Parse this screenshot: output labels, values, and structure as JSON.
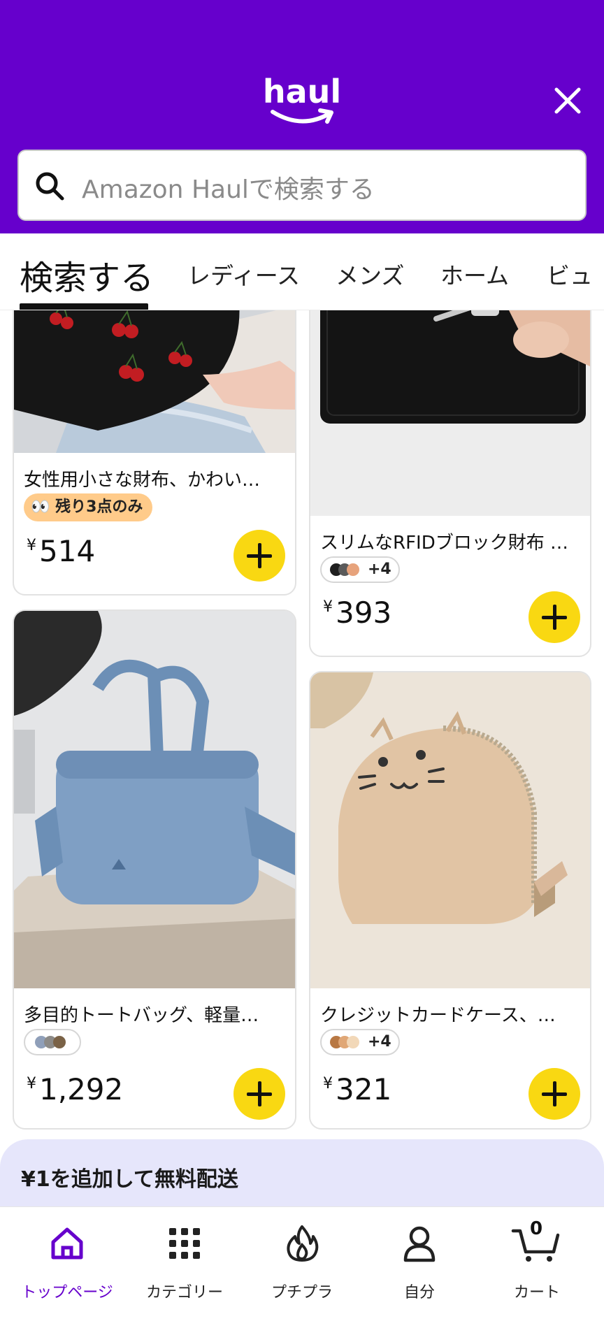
{
  "header": {
    "logo_text": "haul",
    "search_placeholder": "Amazon Haulで検索する"
  },
  "tabs": [
    {
      "label": "検索する",
      "active": true
    },
    {
      "label": "レディース"
    },
    {
      "label": "メンズ"
    },
    {
      "label": "ホーム"
    },
    {
      "label": "ビュ"
    }
  ],
  "products": [
    {
      "title": "女性用小さな財布、かわい…",
      "badge": "残り3点のみ",
      "price_currency": "¥",
      "price": "514"
    },
    {
      "title": "スリムなRFIDブロック財布 …",
      "swatch_more": "+4",
      "price_currency": "¥",
      "price": "393"
    },
    {
      "title": "多目的トートバッグ、軽量…",
      "price_currency": "¥",
      "price": "1,292"
    },
    {
      "title": "クレジットカードケース、…",
      "swatch_more": "+4",
      "price_currency": "¥",
      "price": "321"
    }
  ],
  "banner": {
    "text": "¥1を追加して無料配送"
  },
  "bottom_nav": [
    {
      "label": "トップページ",
      "icon": "home-icon",
      "active": true
    },
    {
      "label": "カテゴリー",
      "icon": "grid-icon"
    },
    {
      "label": "プチプラ",
      "icon": "flame-icon"
    },
    {
      "label": "自分",
      "icon": "person-icon"
    },
    {
      "label": "カート",
      "icon": "cart-icon",
      "count": "0"
    }
  ],
  "colors": {
    "brand": "#6600cc",
    "add_button": "#f9d812",
    "banner_bg": "#e6e6fb",
    "stock_badge": "#ffcb8a"
  }
}
